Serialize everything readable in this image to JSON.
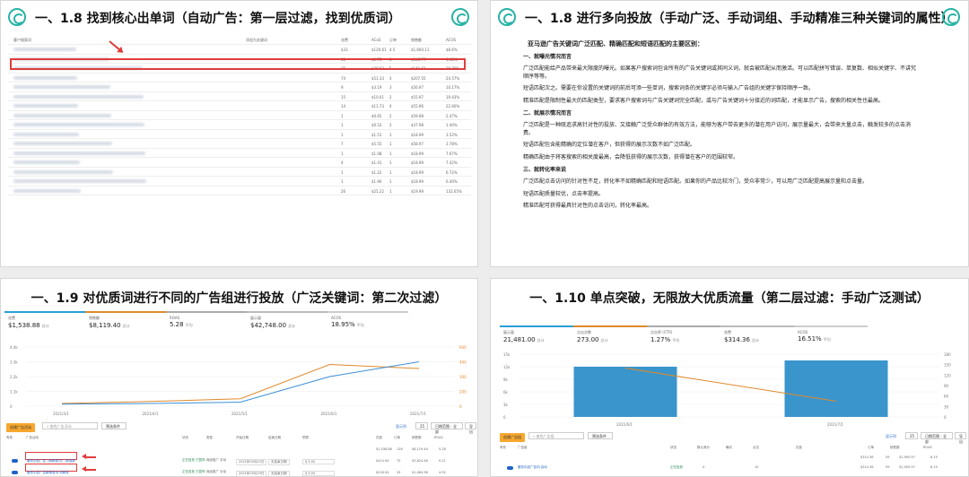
{
  "slides": {
    "s1": {
      "title": "一、1.8 找到核心出单词（自动广告：第一层过滤，找到优质词）",
      "table": {
        "headers": [
          "客户搜索词",
          "添加为关键词",
          "花费",
          "ACoS",
          "订单",
          "销售额",
          "ACOS"
        ],
        "rows": [
          [
            "",
            "",
            "$33",
            "$120.61",
            "4.5",
            "$1,660.11",
            "$8.6%"
          ],
          [
            "",
            "",
            "13",
            "$3.75",
            "3",
            "$345.77",
            "1.48%"
          ],
          [
            "",
            "",
            "36",
            "$29.62",
            "5",
            "$141.61",
            "20.70%"
          ],
          [
            "",
            "",
            "74",
            "$51.33",
            "4",
            "$207.55",
            "24.57%"
          ],
          [
            "",
            "",
            "9",
            "$3.19",
            "3",
            "$56.97",
            "10.17%"
          ],
          [
            "",
            "",
            "15",
            "$10.01",
            "2",
            "$55.97",
            "19.43%"
          ],
          [
            "",
            "",
            "14",
            "$11.73",
            "4",
            "$55.96",
            "22.60%"
          ],
          [
            "",
            "",
            "1",
            "$0.65",
            "2",
            "$59.98",
            "2.47%"
          ],
          [
            "",
            "",
            "1",
            "$0.53",
            "2",
            "$37.98",
            "1.40%"
          ],
          [
            "",
            "",
            "1",
            "$1.51",
            "1",
            "$18.99",
            "3.52%"
          ],
          [
            "",
            "",
            "7",
            "$5.55",
            "1",
            "$58.97",
            "3.78%"
          ],
          [
            "",
            "",
            "1",
            "$1.08",
            "1",
            "$18.99",
            "7.67%"
          ],
          [
            "",
            "",
            "4",
            "$1.41",
            "1",
            "$18.99",
            "7.42%"
          ],
          [
            "",
            "",
            "1",
            "$1.22",
            "1",
            "$18.99",
            "6.72%"
          ],
          [
            "",
            "",
            "1",
            "$1.90",
            "1",
            "$18.99",
            "6.40%"
          ],
          [
            "",
            "",
            "26",
            "$25.22",
            "1",
            "$19.99",
            "132.65%"
          ]
        ]
      }
    },
    "s2": {
      "title": "一、1.8 进行多向投放（手动广泛、手动词组、手动精准三种关键词的属性）",
      "intro": "亚马逊广告关键词广泛匹配、精确匹配和短语匹配的主要区别：",
      "blocks": [
        {
          "type": "sec",
          "text": "一、就曝光情况而言"
        },
        {
          "type": "para",
          "text": "广泛匹配能给产品带来最大限度的曝光。如果客户搜索词包含所有的广告关键词或其同义词，就会被匹配从而激活。可以匹配拼写错误、单复数、相似关键字、不讲究顺序等等。"
        },
        {
          "type": "para",
          "text": "短语匹配次之。需要在你设置的关键词的前后可添一些单词，搜索词条的关键字必须与输入广告组的关键字保持顺序一致。"
        },
        {
          "type": "para",
          "text": "精准匹配是限制性最大的匹配类型，要求客户搜索词与广告关键词完全匹配，或与广告关键词十分接近的词匹配，才能显示广告，搜索的相关性也最高。"
        },
        {
          "type": "sec",
          "text": "二、就展示情况而言"
        },
        {
          "type": "para",
          "text": "广泛匹配是一种既追求高针对性的投放、又接触广泛受众群体的有效方法，能够为客户带去更多的潜在用户访问，展示量最大，会带来大量点击，触发较多的点击消费。"
        },
        {
          "type": "para",
          "text": "短语匹配包含能精确的定位潜在客户，但获得的展示次数不如广泛匹配。"
        },
        {
          "type": "para",
          "text": "精确匹配由于将客搜索的相关度最高，会降低获得的展示次数，获得潜在客户的范围较窄。"
        },
        {
          "type": "sec",
          "text": "三、就转化率来说"
        },
        {
          "type": "para",
          "text": "广泛匹配点击访问的针对性不足，转化率不如精确匹配和短语匹配。如果你的产品比较冷门，受众非常少，可以用广泛匹配提高展示量和点击量。"
        },
        {
          "type": "para",
          "text": "短语匹配质量较优，点击率提高。"
        },
        {
          "type": "para",
          "text": "精准匹配可获得最具针对性的点击访问，转化率最高。"
        }
      ]
    },
    "s3": {
      "title": "一、1.9 对优质词进行不同的广告组进行投放（广泛关键词：第二次过滤）",
      "stats": [
        {
          "label": "花费",
          "value": "$1,538.88",
          "unit": "总计"
        },
        {
          "label": "销售额",
          "value": "$8,119.40",
          "unit": "总计"
        },
        {
          "label": "ROAS",
          "value": "5.28",
          "unit": "平均"
        },
        {
          "label": "展示量",
          "value": "$42,748.00",
          "unit": "总计"
        },
        {
          "label": "ACOS",
          "value": "18.95%",
          "unit": "平均"
        }
      ],
      "x_ticks": [
        "2021/4/1",
        "2021/4/1",
        "2021/5/1",
        "2021/6/1",
        "2021/7/1"
      ],
      "y_left": [
        "4.4k",
        "3.3k",
        "2.2k",
        "1.1k",
        "0"
      ],
      "y_right": [
        "600",
        "400",
        "300",
        "200",
        "0"
      ],
      "create_btn": "创建广告活动",
      "search_placeholder": "查找广告活动",
      "filter_label": "筛选条件",
      "date_label": "日期范围 - 全部",
      "export_label": "导出",
      "cols": [
        "有效",
        "广告活动",
        "状态",
        "类型",
        "开始日期",
        "结束日期",
        "预算",
        "花费",
        "订单",
        "销售额",
        "ROAS"
      ],
      "rows": [
        {
          "name": "",
          "status": "",
          "type": "",
          "start": "",
          "end": "",
          "budget": "",
          "spend": "$1,538.88",
          "orders": "128",
          "sales": "$8,119.40",
          "roas": "5.28"
        },
        {
          "name": "服务中品广告（新精准词）-精准新",
          "status": "正在投放 已暂停",
          "type": "商品推广 手动",
          "start": "2021年05月22日",
          "end": "无结束日期",
          "budget": "$ 5.00",
          "spend": "$414.94",
          "orders": "75",
          "sales": "$3,824.46",
          "roas": "9.21"
        },
        {
          "name": "服务中品广告新精准词-词精准",
          "status": "正在投放 已暂停",
          "type": "商品推广 手动",
          "start": "2021年05月19日",
          "end": "无结束日期",
          "budget": "$ 5.00",
          "spend": "$216.54",
          "orders": "35",
          "sales": "$1,064.98",
          "roas": "4.92"
        }
      ],
      "chart_data": {
        "type": "line",
        "x": [
          "2021/3/1",
          "2021/4/1",
          "2021/5/1",
          "2021/6/1",
          "2021/7/1"
        ],
        "series": [
          {
            "name": "",
            "color": "#e0892b",
            "values": [
              0.2,
              0.35,
              0.55,
              3.1,
              2.8
            ]
          },
          {
            "name": "",
            "color": "#3c8fd8",
            "values": [
              0.15,
              0.2,
              0.3,
              2.2,
              3.3
            ]
          }
        ],
        "ylim": [
          0,
          4.4
        ]
      }
    },
    "s4": {
      "title": "一、1.10 单点突破，无限放大优质流量（第二层过滤：手动广泛测试）",
      "stats": [
        {
          "label": "展示量",
          "value": "21,481.00",
          "unit": "总计"
        },
        {
          "label": "点击次数",
          "value": "273.00",
          "unit": "总计"
        },
        {
          "label": "点击率 (CTR)",
          "value": "1.27%",
          "unit": "平均"
        },
        {
          "label": "花费",
          "value": "$314.36",
          "unit": "总计"
        },
        {
          "label": "ACOS",
          "value": "16.51%",
          "unit": "平均"
        }
      ],
      "x_ticks": [
        "2021/6/1",
        "2021/7/1"
      ],
      "y_left": [
        "15k",
        "12k",
        "9k",
        "6k",
        "3k",
        "0"
      ],
      "y_right": [
        "180",
        "150",
        "120",
        "90",
        "60",
        "30",
        "0"
      ],
      "create_btn": "创建广告组",
      "search_placeholder": "查找广告组",
      "filter_label": "筛选条件",
      "date_label": "日期范围 - 全部",
      "export_label": "导出",
      "cols": [
        "有效",
        "广告组",
        "状态",
        "默认竞价",
        "曝光",
        "点击",
        "花费",
        "订单",
        "销售额",
        "ROAS"
      ],
      "rows": [
        {
          "name": "",
          "status": "",
          "bid": "",
          "impr": "",
          "clicks": "",
          "spend": "$314.36",
          "orders": "59",
          "sales": "$1,905.97",
          "roas": "6.15"
        },
        {
          "name": "服务中品广告词-自动",
          "status": "正在投放",
          "bid": "4",
          "impr": "",
          "clicks": "10",
          "spend": "$314.36",
          "orders": "59",
          "sales": "$1,905.97",
          "roas": "6.15"
        }
      ],
      "chart_data": {
        "type": "bar",
        "categories": [
          "2021/6/1",
          "2021/7/1"
        ],
        "values": [
          12000,
          13500
        ],
        "line_values": [
          140,
          45
        ],
        "bar_color": "#3a95cc",
        "line_color": "#e0892b",
        "ylim": [
          0,
          15000
        ],
        "y2lim": [
          0,
          180
        ]
      }
    }
  }
}
